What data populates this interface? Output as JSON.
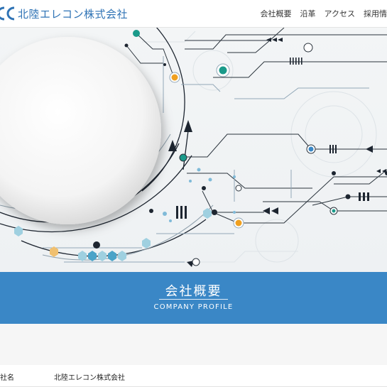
{
  "header": {
    "company_name": "北陸エレコン株式会社",
    "logo_icon": "company-logo-icon"
  },
  "nav": {
    "items": [
      "会社概要",
      "沿革",
      "アクセス",
      "採用情"
    ]
  },
  "banner": {
    "title": "会社概要",
    "subtitle": "COMPANY PROFILE",
    "color": "#3a87c6"
  },
  "profile": {
    "rows": [
      {
        "label": "社名",
        "value": "北陸エレコン株式会社"
      }
    ]
  },
  "colors": {
    "brand": "#2f73b5",
    "teal": "#1a9a8a",
    "orange": "#f0a020"
  }
}
